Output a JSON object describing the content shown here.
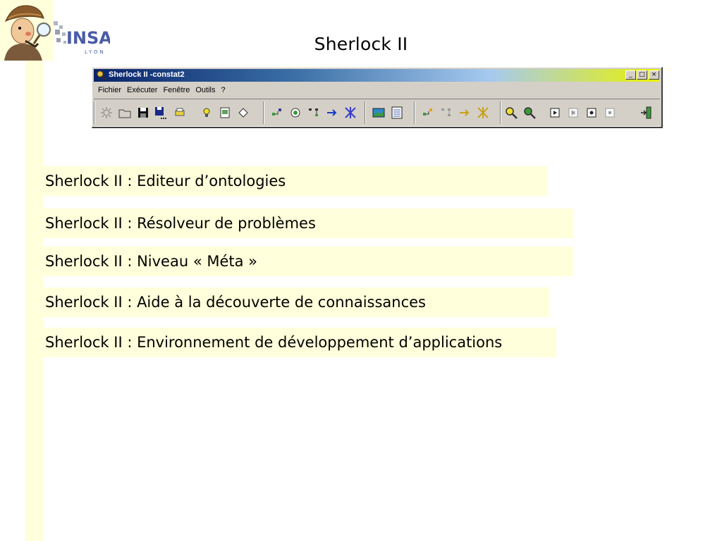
{
  "slide": {
    "title": "Sherlock II"
  },
  "logo": {
    "insa_text": "INSA",
    "insa_subtext": "LYON"
  },
  "window": {
    "title": "Sherlock II -constat2",
    "controls": {
      "minimize": "_",
      "maximize": "□",
      "close": "×"
    },
    "menu": [
      "Fichier",
      "Exécuter",
      "Fenêtre",
      "Outils",
      "?"
    ],
    "toolbar_icons": [
      "new-icon",
      "open-icon",
      "save-icon",
      "save-all-icon",
      "print-icon",
      "bulb-icon",
      "notes-icon",
      "diamond-icon",
      "graph-icon",
      "globe-icon",
      "tree-icon",
      "arrow-icon",
      "network-icon",
      "image-icon",
      "list-icon",
      "graph2-icon",
      "tree2-icon",
      "arrow2-icon",
      "network2-icon",
      "search-icon",
      "search2-icon",
      "play-icon",
      "step-icon",
      "record-icon",
      "stop-icon",
      "exit-icon"
    ]
  },
  "items": [
    "Sherlock II : Editeur d’ontologies",
    "Sherlock II : Résolveur de problèmes",
    "Sherlock II : Niveau « Méta »",
    "Sherlock II : Aide à la découverte de connaissances",
    "Sherlock II : Environnement de développement d’applications"
  ],
  "colors": {
    "band": "#ffffdb",
    "titlebar_start": "#0a246a",
    "titlebar_end": "#eaf200",
    "window_bg": "#d4d0c8"
  }
}
